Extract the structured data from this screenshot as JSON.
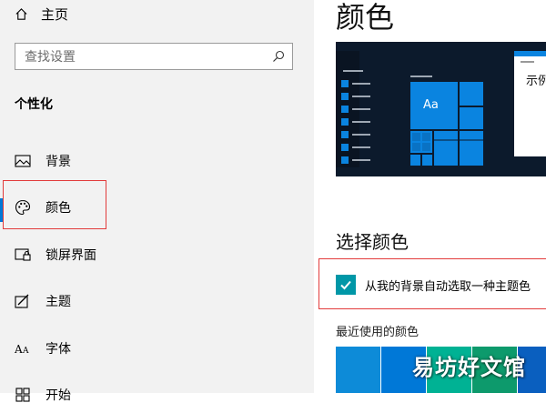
{
  "sidebar": {
    "home_label": "主页",
    "search_placeholder": "查找设置",
    "section_title": "个性化",
    "items": [
      {
        "label": "背景",
        "icon": "picture-icon"
      },
      {
        "label": "颜色",
        "icon": "palette-icon",
        "active": true
      },
      {
        "label": "锁屏界面",
        "icon": "lock-screen-icon"
      },
      {
        "label": "主题",
        "icon": "theme-icon"
      },
      {
        "label": "字体",
        "icon": "font-icon"
      },
      {
        "label": "开始",
        "icon": "start-icon"
      }
    ]
  },
  "main": {
    "title": "颜色",
    "preview": {
      "tile_text": "Aa",
      "window_text": "示例"
    },
    "choose_color_title": "选择颜色",
    "auto_pick_label": "从我的背景自动选取一种主题色",
    "auto_pick_checked": true,
    "recent_colors_title": "最近使用的颜色",
    "recent_colors": [
      "#0d8bd8",
      "#0078d7",
      "#00b294",
      "#0d9a6c",
      "#0a5fbf"
    ]
  },
  "watermark": "易坊好文馆",
  "colors": {
    "accent": "#0078d7",
    "highlight_box": "#e23b3b",
    "checkbox": "#0097a7"
  }
}
